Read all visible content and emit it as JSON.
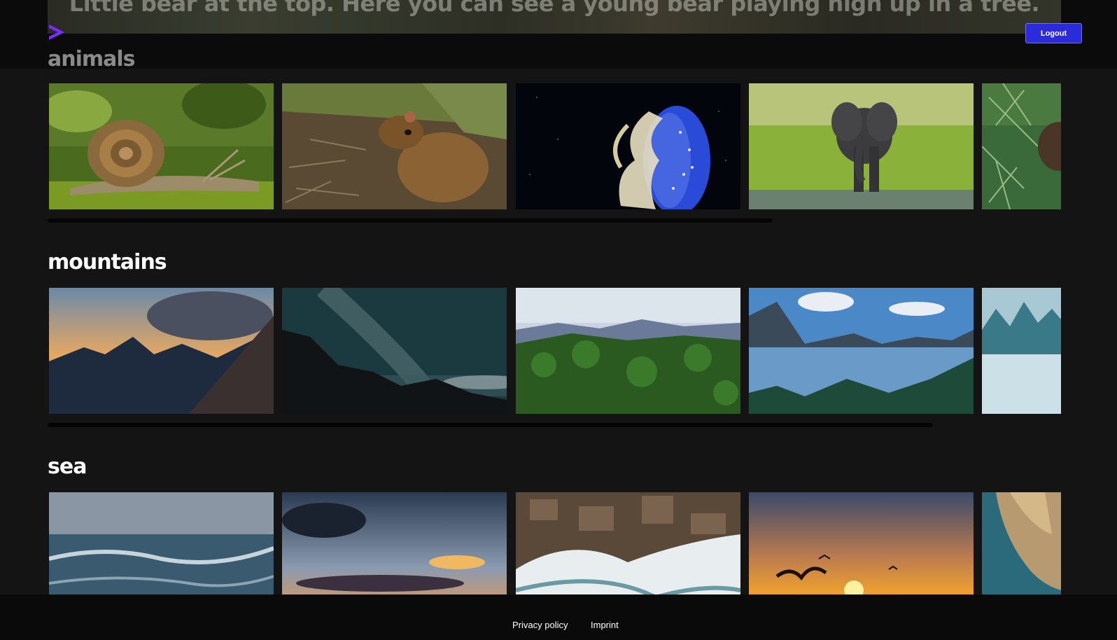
{
  "hero": {
    "caption": "Little bear at the top. Here you can see a young bear playing high up in a tree."
  },
  "header": {
    "logo_icon": "chevron-right-icon",
    "logout_label": "Logout",
    "accent": "#2b2bdc"
  },
  "sections": [
    {
      "title": "animals",
      "tiles": [
        "snail",
        "agouti",
        "jellyfish",
        "elephant",
        "pine-branch"
      ]
    },
    {
      "title": "mountains",
      "tiles": [
        "sunset-peaks",
        "milky-way-ridge",
        "forest-valley",
        "cloud-sea-lake",
        "misty-karst"
      ]
    },
    {
      "title": "sea",
      "tiles": [
        "stormy-waves",
        "sunrays-over-sea",
        "rocky-shore-aerial",
        "sunset-gulls",
        "coastal-cliff"
      ]
    }
  ],
  "footer": {
    "privacy_label": "Privacy policy",
    "imprint_label": "Imprint"
  }
}
